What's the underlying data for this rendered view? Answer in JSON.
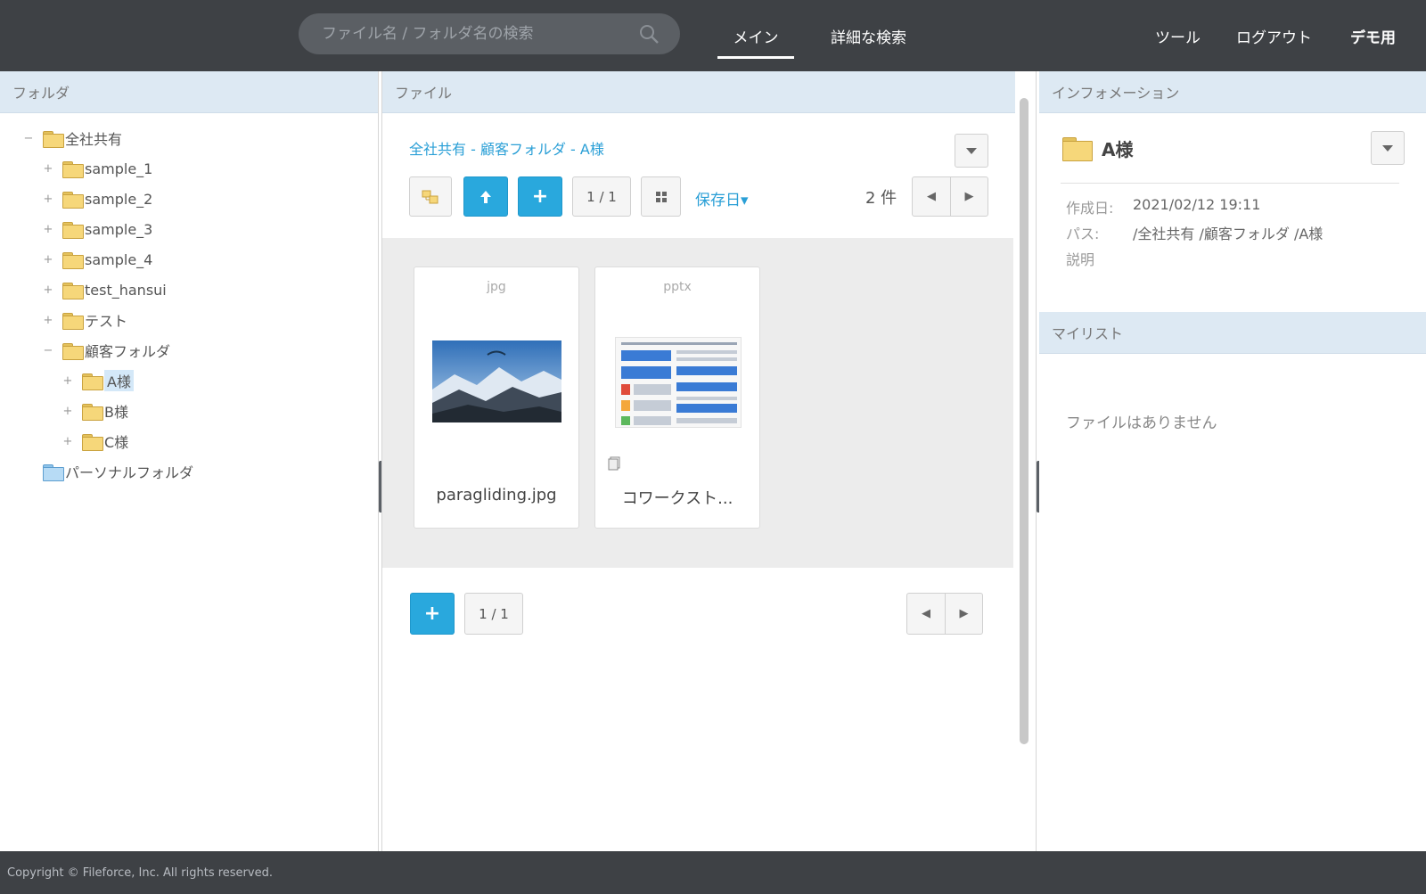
{
  "header": {
    "search_placeholder": "ファイル名 / フォルダ名の検索",
    "nav": {
      "main": "メイン",
      "advanced_search": "詳細な検索",
      "tools": "ツール",
      "logout": "ログアウト",
      "user": "デモ用"
    }
  },
  "folders": {
    "title": "フォルダ",
    "tree": [
      {
        "label": "全社共有",
        "toggle": "−"
      },
      {
        "label": "sample_1",
        "toggle": "+"
      },
      {
        "label": "sample_2",
        "toggle": "+"
      },
      {
        "label": "sample_3",
        "toggle": "+"
      },
      {
        "label": "sample_4",
        "toggle": "+"
      },
      {
        "label": "test_hansui",
        "toggle": "+"
      },
      {
        "label": "テスト",
        "toggle": "+"
      },
      {
        "label": "顧客フォルダ",
        "toggle": "−"
      },
      {
        "label": "A様",
        "toggle": "+"
      },
      {
        "label": "B様",
        "toggle": "+"
      },
      {
        "label": "C様",
        "toggle": "+"
      },
      {
        "label": "パーソナルフォルダ",
        "toggle": ""
      }
    ]
  },
  "files": {
    "title": "ファイル",
    "breadcrumb": "全社共有 - 顧客フォルダ - A様",
    "page": "1 / 1",
    "sort_label": "保存日▾",
    "count": "2 件",
    "add_label": "+",
    "items": [
      {
        "ext": "jpg",
        "name": "paragliding.jpg"
      },
      {
        "ext": "pptx",
        "name": "コワークスト..."
      }
    ],
    "bottom_page": "1 / 1"
  },
  "info": {
    "title": "インフォメーション",
    "folder_name": "A様",
    "created_label": "作成日:",
    "created_value": "2021/02/12 19:11",
    "path_label": "パス:",
    "path_value": "/全社共有 /顧客フォルダ /A様",
    "desc_label": "説明",
    "mylist_title": "マイリスト",
    "empty_text": "ファイルはありません"
  },
  "footer": {
    "copyright": "Copyright © Fileforce, Inc. All rights reserved."
  },
  "colors": {
    "topbar": "#3e4145",
    "accent_blue": "#29a8dd",
    "panel_header": "#dde9f3",
    "folder_yellow": "#f6d77a"
  }
}
